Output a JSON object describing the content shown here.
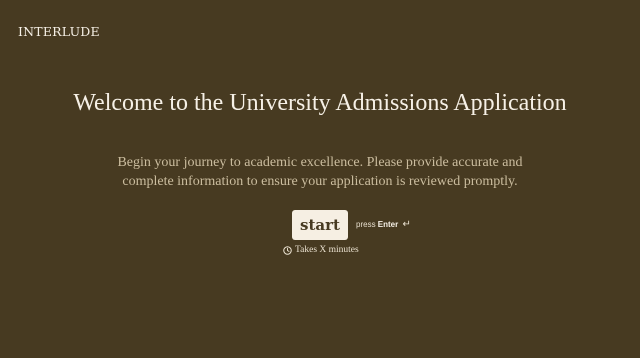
{
  "brand": {
    "name": "INTERLUDE"
  },
  "welcome": {
    "title": "Welcome to the University Admissions Application",
    "subtitle": "Begin your journey to academic excellence. Please provide accurate and complete information to ensure your application is reviewed promptly.",
    "start_label": "start",
    "press_prefix": "press",
    "press_key": "Enter",
    "enter_glyph": "↵",
    "duration_text": "Takes X minutes",
    "clock_icon": "clock-icon"
  },
  "colors": {
    "background": "#473a21",
    "button": "#f6efe3",
    "text": "#f6f0e6",
    "muted_text": "#cbbd9f"
  }
}
